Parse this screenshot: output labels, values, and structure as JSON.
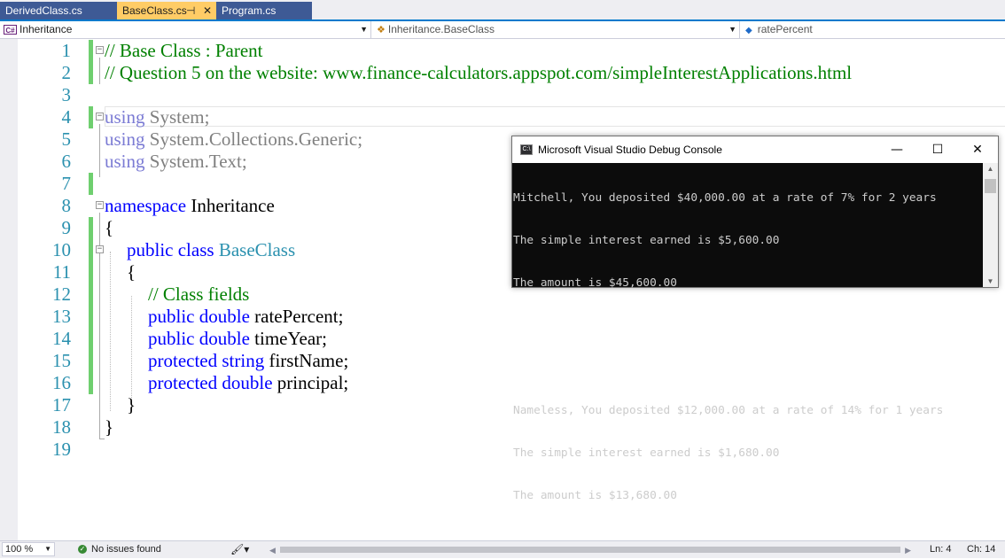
{
  "tabs": [
    {
      "label": "DerivedClass.cs",
      "active": false
    },
    {
      "label": "BaseClass.cs",
      "active": true,
      "pin": "⊣",
      "close": "✕"
    },
    {
      "label": "Program.cs",
      "active": false
    }
  ],
  "navbar": {
    "project": "Inheritance",
    "type": "Inheritance.BaseClass",
    "member": "ratePercent"
  },
  "editor": {
    "line_numbers": [
      "1",
      "2",
      "3",
      "4",
      "5",
      "6",
      "7",
      "8",
      "9",
      "10",
      "11",
      "12",
      "13",
      "14",
      "15",
      "16",
      "17",
      "18",
      "19"
    ],
    "lines": {
      "l1": "// Base Class : Parent",
      "l2": "// Question 5 on the website: www.finance-calculators.appspot.com/simpleInterestApplications.html",
      "l4_kw": "using",
      "l4_rest": " System;",
      "l5_kw": "using",
      "l5_rest": " System.Collections.Generic;",
      "l6_kw": "using",
      "l6_rest": " System.Text;",
      "l8_kw": "namespace",
      "l8_rest": " Inheritance",
      "l9": "{",
      "l10_kw": "public class",
      "l10_type": "BaseClass",
      "l11": "{",
      "l12": "// Class fields",
      "l13_kw": "public double",
      "l13_rest": " ratePercent;",
      "l14_kw": "public double",
      "l14_rest": " timeYear;",
      "l15_kw": "protected string",
      "l15_rest": " firstName;",
      "l16_kw": "protected double",
      "l16_rest": " principal;",
      "l17": "}",
      "l18": "}"
    }
  },
  "console": {
    "title": "Microsoft Visual Studio Debug Console",
    "icon_label": "C:\\",
    "minimize": "—",
    "maximize": "☐",
    "close": "✕",
    "output": [
      "Mitchell, You deposited $40,000.00 at a rate of 7% for 2 years",
      "The simple interest earned is $5,600.00",
      "The amount is $45,600.00",
      "",
      "",
      "Nameless, You deposited $12,000.00 at a rate of 14% for 1 years",
      "The simple interest earned is $1,680.00",
      "The amount is $13,680.00"
    ]
  },
  "status": {
    "zoom": "100 %",
    "issues": "No issues found",
    "ln": "Ln: 4",
    "ch": "Ch: 14"
  },
  "colors": {
    "accent": "#007acc",
    "active_tab": "#ffcc66",
    "inactive_tab": "#3e5a95",
    "keyword": "#0000ff",
    "comment": "#008000",
    "type": "#2b91af",
    "change_bar": "#6fcf6f"
  }
}
